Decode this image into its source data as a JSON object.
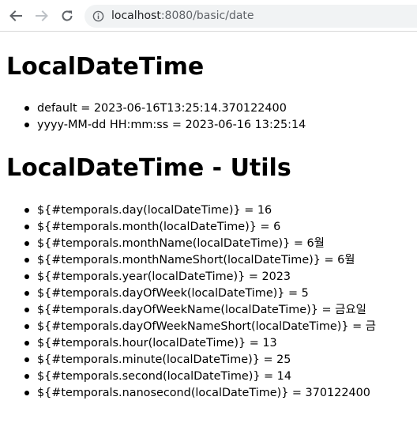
{
  "browser": {
    "url_host": "localhost",
    "url_rest": ":8080/basic/date"
  },
  "sections": [
    {
      "heading": "LocalDateTime",
      "items": [
        "default = 2023-06-16T13:25:14.370122400",
        "yyyy-MM-dd HH:mm:ss = 2023-06-16 13:25:14"
      ]
    },
    {
      "heading": "LocalDateTime - Utils",
      "items": [
        "${#temporals.day(localDateTime)} = 16",
        "${#temporals.month(localDateTime)} = 6",
        "${#temporals.monthName(localDateTime)} = 6월",
        "${#temporals.monthNameShort(localDateTime)} = 6월",
        "${#temporals.year(localDateTime)} = 2023",
        "${#temporals.dayOfWeek(localDateTime)} = 5",
        "${#temporals.dayOfWeekName(localDateTime)} = 금요일",
        "${#temporals.dayOfWeekNameShort(localDateTime)} = 금",
        "${#temporals.hour(localDateTime)} = 13",
        "${#temporals.minute(localDateTime)} = 25",
        "${#temporals.second(localDateTime)} = 14",
        "${#temporals.nanosecond(localDateTime)} = 370122400"
      ]
    }
  ]
}
